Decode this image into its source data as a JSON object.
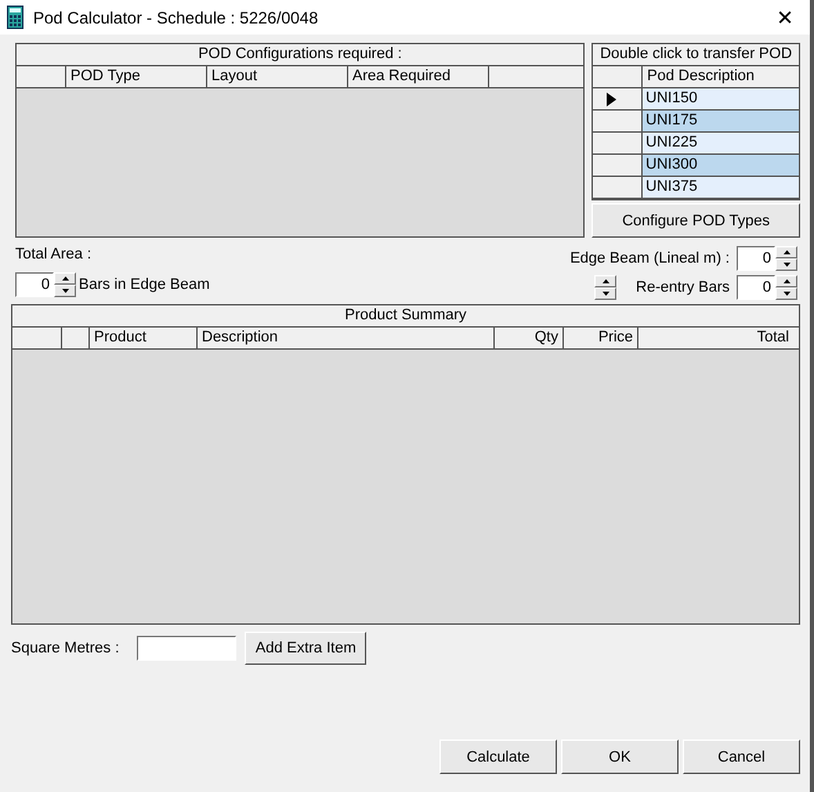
{
  "window": {
    "title": "Pod Calculator - Schedule : 5226/0048",
    "close": "✕"
  },
  "pod_configurations": {
    "title": "POD Configurations required :",
    "columns": [
      "POD Type",
      "Layout",
      "Area Required"
    ]
  },
  "pod_list": {
    "title": "Double click to transfer POD",
    "column": "Pod Description",
    "rows": [
      {
        "label": "UNI150",
        "selected": true
      },
      {
        "label": "UNI175",
        "selected": false
      },
      {
        "label": "UNI225",
        "selected": false
      },
      {
        "label": "UNI300",
        "selected": false
      },
      {
        "label": "UNI375",
        "selected": false
      }
    ]
  },
  "configure_button": "Configure POD Types",
  "total_area_label": "Total Area :",
  "bars_in_edge_beam": {
    "value": "0",
    "label": "Bars in Edge Beam"
  },
  "edge_beam": {
    "label": "Edge Beam (Lineal m) :",
    "value": "0"
  },
  "re_entry_bars": {
    "label": "Re-entry Bars",
    "value": "0"
  },
  "product_summary": {
    "title": "Product Summary",
    "columns": [
      "Product",
      "Description",
      "Qty",
      "Price",
      "Total"
    ]
  },
  "square_metres": {
    "label": "Square Metres :"
  },
  "add_extra_button": "Add Extra Item",
  "buttons": [
    "Calculate",
    "OK",
    "Cancel"
  ]
}
